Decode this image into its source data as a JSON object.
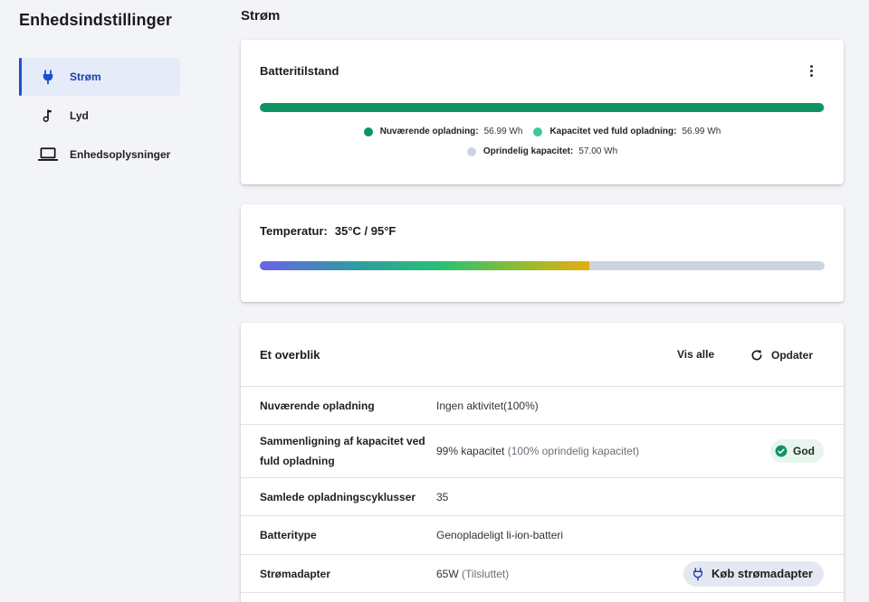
{
  "sidebar": {
    "title": "Enhedsindstillinger",
    "items": [
      {
        "label": "Strøm",
        "icon": "plug-icon",
        "active": true
      },
      {
        "label": "Lyd",
        "icon": "music-note-icon",
        "active": false
      },
      {
        "label": "Enhedsoplysninger",
        "icon": "laptop-icon",
        "active": false
      }
    ]
  },
  "page": {
    "title": "Strøm"
  },
  "battery": {
    "title": "Batteritilstand",
    "charge_fraction": 0.9988,
    "legend": [
      {
        "name": "Nuværende opladning:",
        "value": "56.99 Wh",
        "color": "#0d9462"
      },
      {
        "name": "Kapacitet ved fuld opladning:",
        "value": "56.99 Wh",
        "color": "#3ec996"
      },
      {
        "name": "Oprindelig kapacitet:",
        "value": "57.00 Wh",
        "color": "#cdd4e1"
      }
    ]
  },
  "temperature": {
    "label": "Temperatur:",
    "value": "35°C / 95°F",
    "fill_fraction": 0.583
  },
  "overview": {
    "title": "Et overblik",
    "view_all": "Vis alle",
    "refresh": "Opdater",
    "rows": [
      {
        "label": "Nuværende opladning",
        "value": "Ingen aktivitet(100%)",
        "muted": ""
      },
      {
        "label": "Sammenligning af kapacitet ved fuld opladning",
        "value": "99% kapacitet",
        "muted": "(100% oprindelig kapacitet)",
        "badge": "God"
      },
      {
        "label": "Samlede opladningscyklusser",
        "value": "35",
        "muted": ""
      },
      {
        "label": "Batteritype",
        "value": "Genopladeligt li-ion-batteri",
        "muted": ""
      },
      {
        "label": "Strømadapter",
        "value": "65W",
        "muted": "(Tilsluttet)",
        "action": "Køb strømadapter"
      }
    ]
  },
  "colors": {
    "accent": "#1a4fd6",
    "battery_fill": "#0d9462",
    "track": "#cdd4e1",
    "good_badge_bg": "#e8f5ee",
    "good_icon": "#0d9462"
  }
}
